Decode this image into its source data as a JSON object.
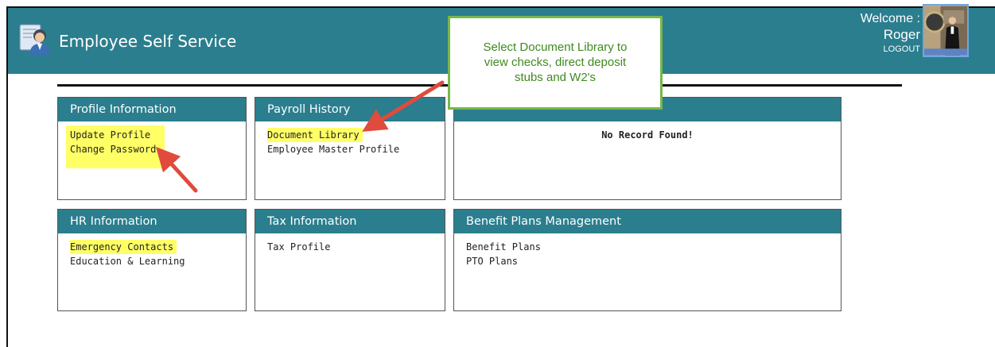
{
  "header": {
    "title": "Employee Self Service",
    "welcome_label": "Welcome :",
    "user_name": "Roger",
    "logout_label": "LOGOUT"
  },
  "panels": {
    "profile": {
      "title": "Profile Information",
      "links": [
        "Update Profile",
        "Change Password"
      ]
    },
    "payroll": {
      "title": "Payroll History",
      "links": [
        "Document Library",
        "Employee Master Profile"
      ]
    },
    "alerts": {
      "empty_text": "No Record Found!"
    },
    "hr": {
      "title": "HR Information",
      "links": [
        "Emergency Contacts",
        "Education & Learning"
      ]
    },
    "tax": {
      "title": "Tax Information",
      "links": [
        "Tax Profile"
      ]
    },
    "benefits": {
      "title": "Benefit Plans Management",
      "links": [
        "Benefit Plans",
        "PTO Plans"
      ]
    }
  },
  "callout": {
    "lines": [
      "Select Document Library to",
      "view checks, direct deposit",
      "stubs and W2's"
    ]
  },
  "colors": {
    "header_bg": "#2b7e8e",
    "highlight": "#ffff66",
    "annotation_arrow": "#e04b3c",
    "callout_border": "#77b84a"
  }
}
